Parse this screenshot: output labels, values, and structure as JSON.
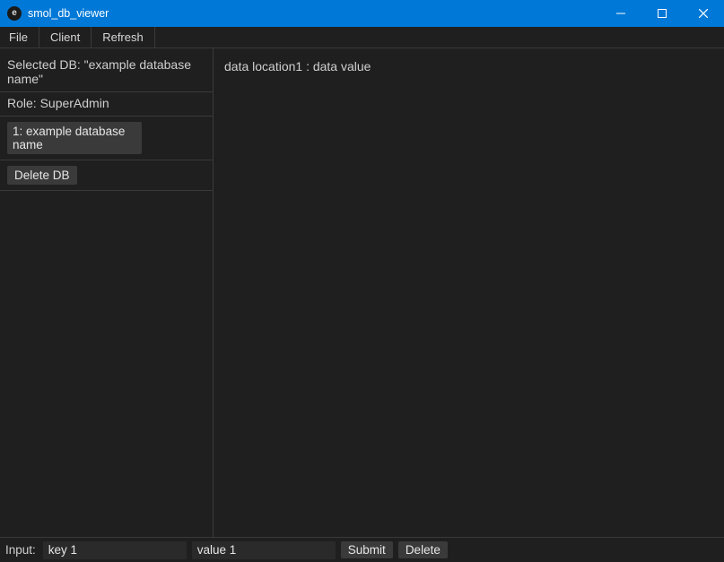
{
  "window": {
    "title": "smol_db_viewer",
    "icon_letter": "e"
  },
  "menu": {
    "file": "File",
    "client": "Client",
    "refresh": "Refresh"
  },
  "sidebar": {
    "selected_db_line": "Selected DB: \"example database name\"",
    "role_line": "Role: SuperAdmin",
    "db_items": [
      {
        "label": "1: example database name"
      }
    ],
    "delete_button": "Delete DB"
  },
  "main": {
    "data_line": "data location1 : data value"
  },
  "bottom": {
    "input_label": "Input:",
    "key_value": "key 1",
    "value_value": "value 1",
    "submit_label": "Submit",
    "delete_label": "Delete"
  }
}
